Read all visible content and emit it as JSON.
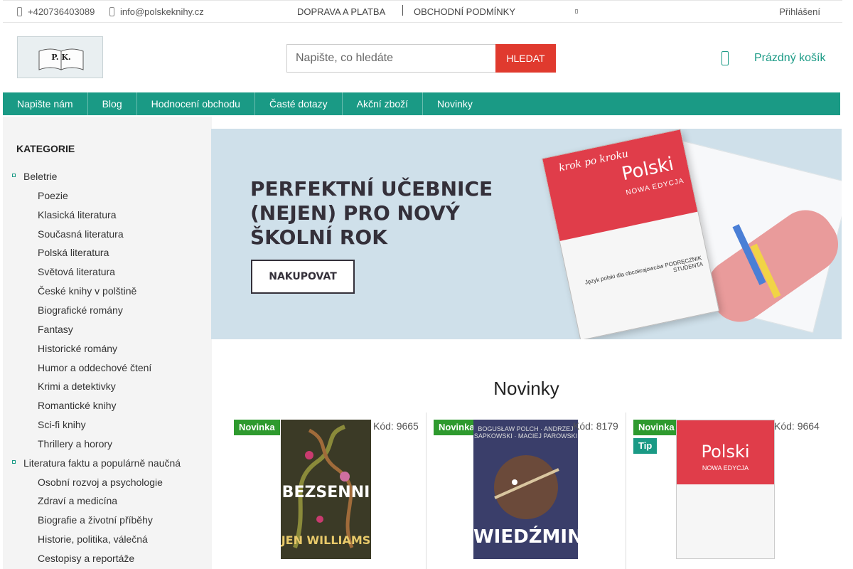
{
  "topbar": {
    "phone": "+420736403089",
    "email": "info@polskeknihy.cz",
    "links": [
      "DOPRAVA A PLATBA",
      "OBCHODNÍ PODMÍNKY"
    ],
    "login": "Přihlášení"
  },
  "header": {
    "logo_text": "P. K.",
    "search_placeholder": "Napište, co hledáte",
    "search_button": "HLEDAT",
    "cart_label": "Prázdný košík"
  },
  "nav": [
    "Napište nám",
    "Blog",
    "Hodnocení obchodu",
    "Časté dotazy",
    "Akční zboží",
    "Novinky"
  ],
  "sidebar": {
    "title": "KATEGORIE",
    "categories": [
      {
        "label": "Beletrie",
        "level": "top"
      },
      {
        "label": "Poezie",
        "level": "sub"
      },
      {
        "label": "Klasická literatura",
        "level": "sub"
      },
      {
        "label": "Současná literatura",
        "level": "sub"
      },
      {
        "label": "Polská literatura",
        "level": "sub"
      },
      {
        "label": "Světová literatura",
        "level": "sub"
      },
      {
        "label": "České knihy v polštině",
        "level": "sub"
      },
      {
        "label": "Biografické romány",
        "level": "sub"
      },
      {
        "label": "Fantasy",
        "level": "sub"
      },
      {
        "label": "Historické romány",
        "level": "sub"
      },
      {
        "label": "Humor a oddechové čtení",
        "level": "sub"
      },
      {
        "label": "Krimi a detektivky",
        "level": "sub"
      },
      {
        "label": "Romantické knihy",
        "level": "sub"
      },
      {
        "label": "Sci-fi knihy",
        "level": "sub"
      },
      {
        "label": "Thrillery a horory",
        "level": "sub"
      },
      {
        "label": "Literatura faktu a populárně naučná",
        "level": "top"
      },
      {
        "label": "Osobní rozvoj a psychologie",
        "level": "sub"
      },
      {
        "label": "Zdraví a medicína",
        "level": "sub"
      },
      {
        "label": "Biografie a životní příběhy",
        "level": "sub"
      },
      {
        "label": "Historie, politika, válečná",
        "level": "sub"
      },
      {
        "label": "Cestopisy a reportáže",
        "level": "sub"
      }
    ]
  },
  "banner": {
    "headline": "PERFEKTNÍ UČEBNICE (NEJEN) PRO NOVÝ ŠKOLNÍ ROK",
    "cta": "NAKUPOVAT",
    "book_script": "krok po kroku",
    "book_title": "Polski",
    "book_subtitle": "NOWA EDYCJA",
    "book_footer": "Język polski dla obcokrajowców PODRĘCZNIK STUDENTA"
  },
  "section_title": "Novinky",
  "products": [
    {
      "badges": [
        "Novinka"
      ],
      "code": "Kód: 9665",
      "cover_title": "BEZSENNI",
      "cover_author": "JEN WILLIAMS"
    },
    {
      "badges": [
        "Novinka"
      ],
      "code": "Kód: 8179",
      "cover_title": "WIEDŹMIN",
      "cover_author": "BOGUSŁAW POLCH · ANDRZEJ SAPKOWSKI · MACIEJ PAROWSKI"
    },
    {
      "badges": [
        "Novinka",
        "Tip"
      ],
      "code": "Kód: 9664",
      "cover_title": "Polski",
      "cover_author": "NOWA EDYCJA"
    }
  ],
  "colors": {
    "accent": "#1a9a85",
    "search_button": "#e03a2e",
    "badge_new": "#2e9a2e"
  }
}
